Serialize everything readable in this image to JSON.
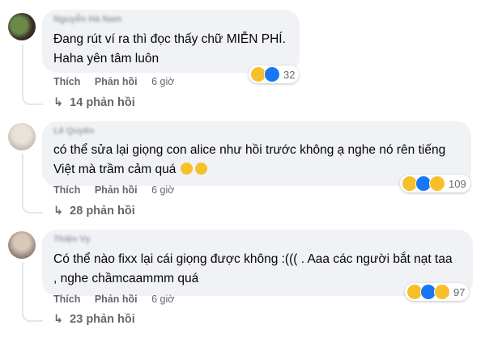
{
  "comments": [
    {
      "author": "Nguyễn Hà Nam",
      "lines": [
        "Đang rút ví ra thì đọc thấy chữ MIỄN PHÍ.",
        "Haha yên tâm luôn"
      ],
      "like_label": "Thích",
      "reply_label": "Phản hồi",
      "time": "6 giờ",
      "reaction_count": "32",
      "replies_label": "14 phản hồi"
    },
    {
      "author": "Lê Quyên",
      "lines": [
        "có thể sửa lại giọng con alice như hồi trước không ạ nghe nó rên tiếng",
        "Việt mà trầm cảm quá"
      ],
      "like_label": "Thích",
      "reply_label": "Phản hồi",
      "time": "6 giờ",
      "reaction_count": "109",
      "replies_label": "28 phản hồi"
    },
    {
      "author": "Thiện Vy",
      "lines": [
        "Có thể nào fixx lại cái giọng được không :((( . Aaa các người bắt nạt taa",
        ", nghe chầmcaammm quá"
      ],
      "like_label": "Thích",
      "reply_label": "Phản hồi",
      "time": "6 giờ",
      "reaction_count": "97",
      "replies_label": "23 phản hồi"
    }
  ],
  "reply_arrow": "↳",
  "icons": [
    "haha-emoji-icon",
    "like-icon",
    "sad-emoji-icon",
    "reply-arrow-icon"
  ],
  "colors": {
    "bubble": "#f0f2f5",
    "meta": "#65676b",
    "like_blue": "#1877f2",
    "emoji_yellow": "#f7c02a"
  }
}
